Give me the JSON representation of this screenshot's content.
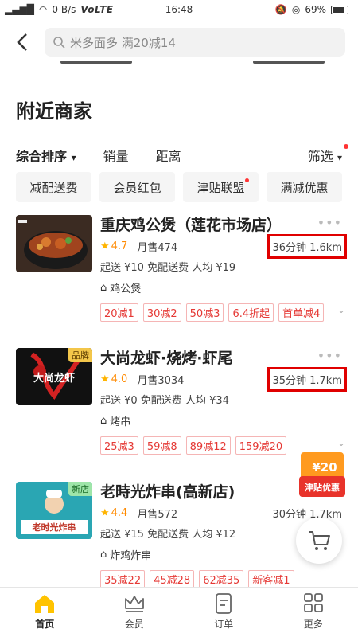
{
  "status_bar": {
    "net": "0 B/s",
    "volte": "VoLTE",
    "time": "16:48",
    "battery": "69%"
  },
  "search": {
    "placeholder": "米多面多 满20减14"
  },
  "section_title": "附近商家",
  "sort": {
    "items": [
      "综合排序",
      "销量",
      "距离"
    ],
    "filter": "筛选"
  },
  "chips": [
    "减配送费",
    "会员红包",
    "津贴联盟",
    "满减优惠"
  ],
  "stores": [
    {
      "name": "重庆鸡公煲（莲花市场店）",
      "rating": "4.7",
      "sales": "月售474",
      "distance": "36分钟  1.6km",
      "delivery": "起送 ¥10  免配送费  人均 ¥19",
      "category": "鸡公煲",
      "tags": [
        "20减1",
        "30减2",
        "50减3",
        "6.4折起",
        "首单减4"
      ]
    },
    {
      "name": "大尚龙虾·烧烤·虾尾",
      "rating": "4.0",
      "sales": "月售3034",
      "distance": "35分钟  1.7km",
      "delivery": "起送 ¥0  免配送费  人均 ¥34",
      "category": "烤串",
      "badge": "品牌",
      "thumb_text": "大尚龙虾",
      "tags": [
        "25减3",
        "59减8",
        "89减12",
        "159减20"
      ]
    },
    {
      "name": "老時光炸串(高新店)",
      "rating": "4.4",
      "sales": "月售572",
      "distance": "30分钟  1.7km",
      "delivery": "起送 ¥15  免配送费  人均 ¥12",
      "category": "炸鸡炸串",
      "badge": "新店",
      "thumb_text": "老时光炸串",
      "tags": [
        "35减22",
        "45减28",
        "62减35",
        "新客减1"
      ]
    }
  ],
  "sticker": {
    "amount": "¥20",
    "label": "津贴优惠"
  },
  "nav": [
    "首页",
    "会员",
    "订单",
    "更多"
  ],
  "colors": {
    "accent": "#ffc300",
    "discount_red": "#e53935",
    "highlight_box": "#e00000"
  }
}
